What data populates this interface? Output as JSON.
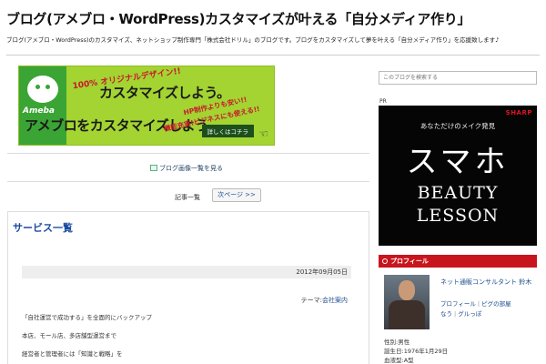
{
  "header": {
    "title": "ブログ(アメブロ・WordPress)カスタマイズが叶える「自分メディア作り」",
    "description": "ブログ(アメブロ・WordPress)のカスタマイズ、ネットショップ制作専門「株式会社ドリル」のブログです。ブログをカスタマイズして夢を叶える「自分メディア作り」を応援致します♪"
  },
  "banner": {
    "ameba": "Ameba",
    "tag1": "100% オリジナルデザイン!!",
    "main1": "カスタマイズしよう。",
    "main2": "アメブロをカスタマイズしよう。",
    "tag2": "HP制作よりも安い!!",
    "tag3": "機能充実!ビジネスにも使える!!",
    "more": "詳しくはコチラ"
  },
  "main": {
    "image_list_link": "ブログ画像一覧を見る",
    "pager": {
      "label": "記事一覧",
      "next": "次ページ >>"
    },
    "entry": {
      "title": "サービス一覧",
      "date": "2012年09月05日",
      "theme_label": "テーマ:",
      "theme_value": "会社案内",
      "lines": [
        "「自社運営で成功する」を全面的にバックアップ",
        "本店、モール店、多店舗型運営まで",
        "経営者と管理者には「知識と戦略」を"
      ]
    }
  },
  "sidebar": {
    "search_placeholder": "このブログを検索する",
    "pr": "PR",
    "ad": {
      "brand": "SHARP",
      "line1": "あなただけのメイク発見",
      "line2": "スマホ",
      "line3": "BEAUTY",
      "line4": "LESSON"
    },
    "profile": {
      "heading": "プロフィール",
      "name": "ネット通販コンサルタント 鈴木",
      "link1": "プロフィール",
      "link2": "ピグの部屋",
      "link3": "なう",
      "link4": "グルっぽ",
      "gender": "性別:男性",
      "birthday": "誕生日:1976年1月29日",
      "blood": "血液型:A型"
    }
  },
  "colors": {
    "accent": "#c8151d",
    "link": "#1a4b8c",
    "banner_green": "#a3d431"
  }
}
